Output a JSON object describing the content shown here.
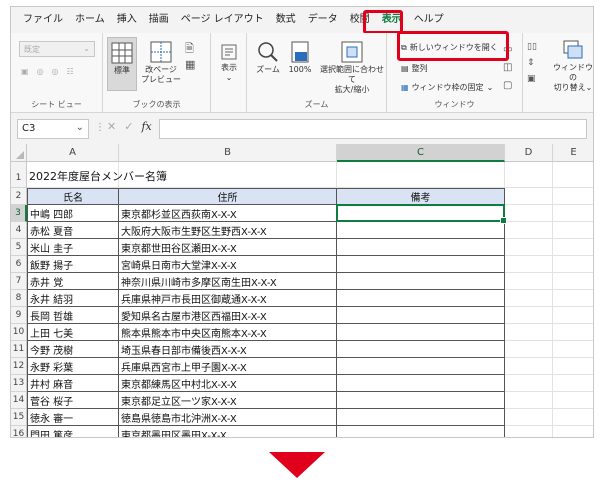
{
  "menu": {
    "tabs": [
      "ファイル",
      "ホーム",
      "挿入",
      "描画",
      "ページ レイアウト",
      "数式",
      "データ",
      "校閲",
      "表示",
      "ヘルプ"
    ],
    "active_tab": "表示"
  },
  "ribbon": {
    "sheet_view": {
      "dropdown": "既定",
      "label": "シート ビュー"
    },
    "workbook_views": {
      "normal": "標準",
      "page_break_1": "改ページ",
      "page_break_2": "プレビュー",
      "label": "ブックの表示"
    },
    "show": {
      "label": "表示"
    },
    "zoom": {
      "zoom": "ズーム",
      "hundred": "100%",
      "fit_1": "選択範囲に合わせて",
      "fit_2": "拡大/縮小",
      "label": "ズーム"
    },
    "window": {
      "new_window": "新しいウィンドウを開く",
      "arrange": "整列",
      "freeze": "ウィンドウ枠の固定",
      "label": "ウィンドウ",
      "switch_1": "ウィンドウの",
      "switch_2": "切り替え"
    }
  },
  "formula_bar": {
    "name_box": "C3",
    "fx": "fx",
    "value": ""
  },
  "columns": [
    "A",
    "B",
    "C",
    "D",
    "E"
  ],
  "rows": [
    "1",
    "2",
    "3",
    "4",
    "5",
    "6",
    "7",
    "8",
    "9",
    "10",
    "11",
    "12",
    "13",
    "14",
    "15",
    "16"
  ],
  "sheet": {
    "title": "2022年度屋台メンバー名簿",
    "headers": {
      "name": "氏名",
      "address": "住所",
      "note": "備考"
    },
    "records": [
      {
        "name": "中嶋 四郎",
        "address": "東京都杉並区西荻南X-X-X"
      },
      {
        "name": "赤松 夏音",
        "address": "大阪府大阪市生野区生野西X-X-X"
      },
      {
        "name": "米山 圭子",
        "address": "東京都世田谷区瀬田X-X-X"
      },
      {
        "name": "飯野 揚子",
        "address": "宮崎県日南市大堂津X-X-X"
      },
      {
        "name": "赤井 覚",
        "address": "神奈川県川崎市多摩区南生田X-X-X"
      },
      {
        "name": "永井 結羽",
        "address": "兵庫県神戸市長田区御蔵通X-X-X"
      },
      {
        "name": "長岡 哲雄",
        "address": "愛知県名古屋市港区西福田X-X-X"
      },
      {
        "name": "上田 七美",
        "address": "熊本県熊本市中央区南熊本X-X-X"
      },
      {
        "name": "今野 茂樹",
        "address": "埼玉県春日部市備後西X-X-X"
      },
      {
        "name": "永野 彩葉",
        "address": "兵庫県西宮市上甲子園X-X-X"
      },
      {
        "name": "井村 麻音",
        "address": "東京都練馬区中村北X-X-X"
      },
      {
        "name": "菅谷 桜子",
        "address": "東京都足立区一ツ家X-X-X"
      },
      {
        "name": "徳永 審一",
        "address": "徳島県徳島市北沖洲X-X-X"
      },
      {
        "name": "門田 篤彦",
        "address": "東京都墨田区墨田X-X-X"
      }
    ]
  },
  "colors": {
    "highlight": "#e0001b",
    "excel_green": "#107c41",
    "header_fill": "#dae3f3"
  }
}
